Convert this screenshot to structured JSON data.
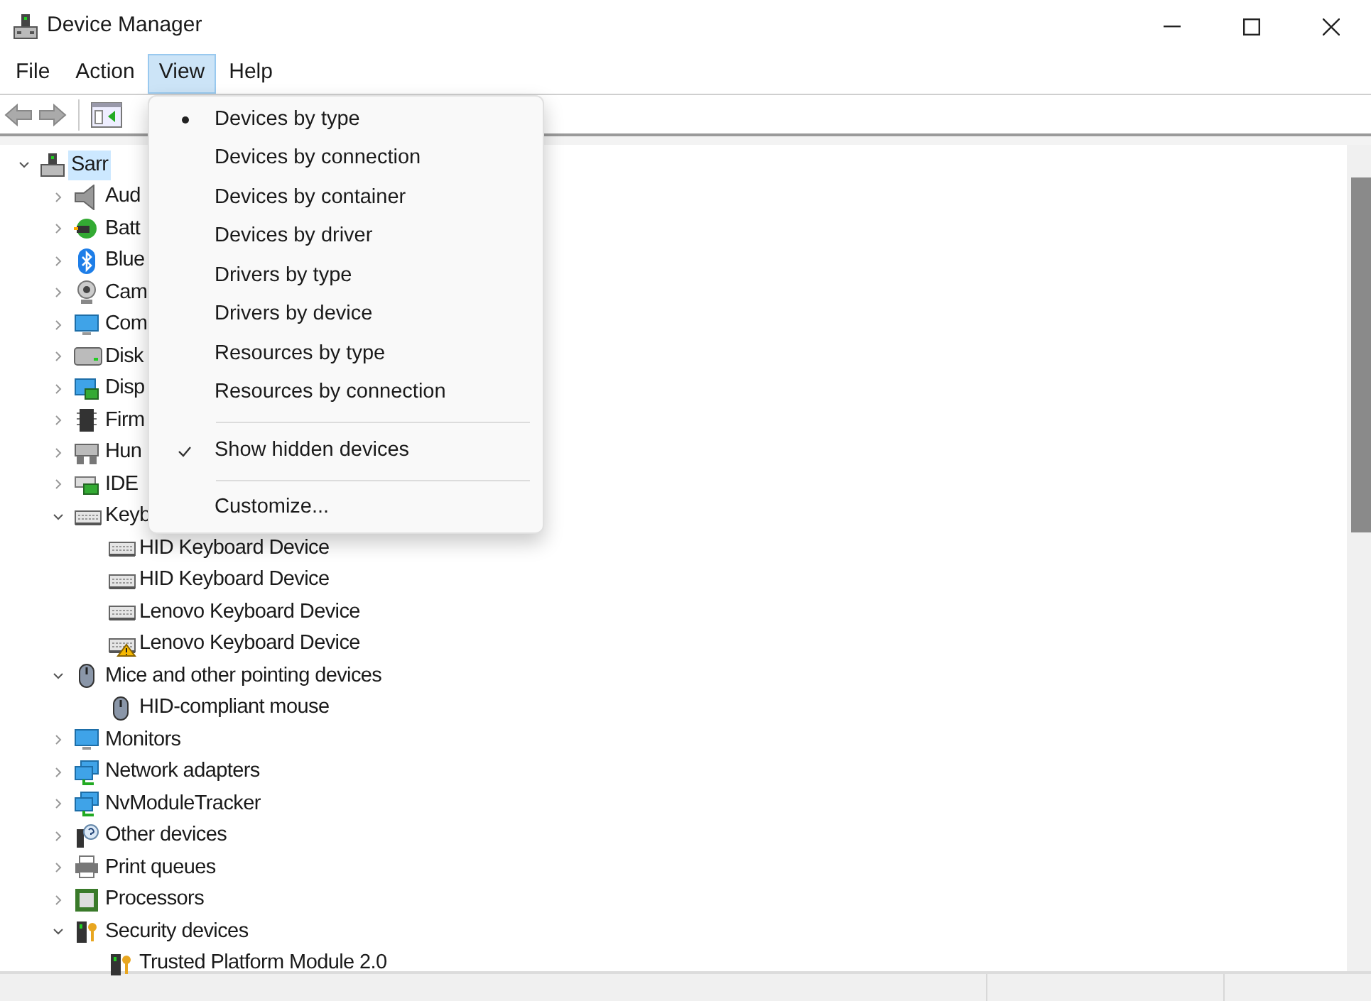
{
  "window": {
    "title": "Device Manager"
  },
  "menu_bar": [
    {
      "label": "File",
      "selected": false
    },
    {
      "label": "Action",
      "selected": false
    },
    {
      "label": "View",
      "selected": true
    },
    {
      "label": "Help",
      "selected": false
    }
  ],
  "view_menu": [
    {
      "kind": "radio",
      "label": "Devices by type",
      "selected": true
    },
    {
      "kind": "radio",
      "label": "Devices by connection",
      "selected": false
    },
    {
      "kind": "radio",
      "label": "Devices by container",
      "selected": false
    },
    {
      "kind": "radio",
      "label": "Devices by driver",
      "selected": false
    },
    {
      "kind": "radio",
      "label": "Drivers by type",
      "selected": false
    },
    {
      "kind": "radio",
      "label": "Drivers by device",
      "selected": false
    },
    {
      "kind": "radio",
      "label": "Resources by type",
      "selected": false
    },
    {
      "kind": "radio",
      "label": "Resources by connection",
      "selected": false
    },
    {
      "kind": "separator"
    },
    {
      "kind": "check",
      "label": "Show hidden devices",
      "checked": true
    },
    {
      "kind": "separator"
    },
    {
      "kind": "command",
      "label": "Customize..."
    }
  ],
  "tree": {
    "label": "Sarr",
    "kind": "computer",
    "expanded": true,
    "selected": true,
    "children": [
      {
        "label": "Aud",
        "kind": "audio",
        "expanded": false
      },
      {
        "label": "Batt",
        "kind": "battery",
        "expanded": false
      },
      {
        "label": "Blue",
        "kind": "bluetooth",
        "expanded": false
      },
      {
        "label": "Cam",
        "kind": "camera",
        "expanded": false
      },
      {
        "label": "Com",
        "kind": "monitor",
        "expanded": false
      },
      {
        "label": "Disk",
        "kind": "disk",
        "expanded": false
      },
      {
        "label": "Disp",
        "kind": "display",
        "expanded": false
      },
      {
        "label": "Firm",
        "kind": "chip",
        "expanded": false
      },
      {
        "label": "Hun",
        "kind": "hid",
        "expanded": false
      },
      {
        "label": "IDE",
        "kind": "ide",
        "expanded": false
      },
      {
        "label": "Keyb",
        "kind": "keyboard",
        "expanded": true,
        "children": [
          {
            "label": "HID Keyboard Device",
            "kind": "keyboard",
            "warning": false
          },
          {
            "label": "HID Keyboard Device",
            "kind": "keyboard",
            "warning": false
          },
          {
            "label": "Lenovo Keyboard Device",
            "kind": "keyboard",
            "warning": false
          },
          {
            "label": "Lenovo Keyboard Device",
            "kind": "keyboard",
            "warning": true
          }
        ]
      },
      {
        "label": "Mice and other pointing devices",
        "kind": "mouse",
        "expanded": true,
        "children": [
          {
            "label": "HID-compliant mouse",
            "kind": "mouse",
            "warning": false
          }
        ]
      },
      {
        "label": "Monitors",
        "kind": "monitor",
        "expanded": false
      },
      {
        "label": "Network adapters",
        "kind": "network",
        "expanded": false
      },
      {
        "label": "NvModuleTracker",
        "kind": "network",
        "expanded": false
      },
      {
        "label": "Other devices",
        "kind": "unknown",
        "expanded": false
      },
      {
        "label": "Print queues",
        "kind": "printer",
        "expanded": false
      },
      {
        "label": "Processors",
        "kind": "processor",
        "expanded": false
      },
      {
        "label": "Security devices",
        "kind": "security",
        "expanded": true,
        "children": [
          {
            "label": "Trusted Platform Module 2.0",
            "kind": "security",
            "warning": false
          }
        ]
      }
    ]
  }
}
